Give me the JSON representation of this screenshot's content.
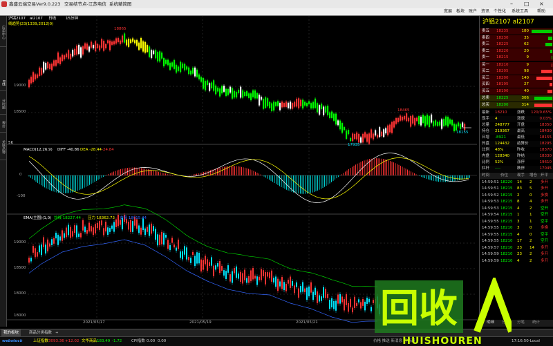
{
  "window": {
    "title": "鑫盛云端交易",
    "version": "Ver9.0.223",
    "center_text": "交易结节点-江苏电信",
    "center_text2": "系统精简图",
    "menu": [
      "宽展",
      "板块",
      "账户",
      "资讯",
      "个性化",
      "系统工具",
      "帮助"
    ]
  },
  "left_tabs": [
    "应用中心",
    "K线",
    "分时图",
    "报价",
    "关联品种"
  ],
  "chart": {
    "header": {
      "contract": "沪铝2107",
      "code": "al2107",
      "mode": "日线",
      "period": "15分钟",
      "indicator": "线趋势(23(1339,2012)0)"
    },
    "price_axis_labels": [
      "19000",
      "18500"
    ],
    "price_annotations": {
      "high": "18865",
      "low": "17935",
      "mid_peak": "18465",
      "last": "18155"
    },
    "macd_header": {
      "label": "MACD(12,26,9)",
      "diff": "DIFF -40.86",
      "dea": "DEA -28.44",
      "macd": "-24.84"
    },
    "macd_axis_labels": [
      "0",
      "-100"
    ],
    "ema_header": {
      "label": "EMA(主图)(1,0)",
      "line1": "均线 18227.44",
      "line2": "压力 18362.73",
      "line3": "支撑 18015.44"
    },
    "ema_axis_labels": [
      "19000",
      "18500",
      "18000"
    ],
    "dates": [
      "2021/05/17",
      "2021/05/19",
      "2021/05/21"
    ],
    "pane_tag": "5K"
  },
  "right_panel": {
    "title": "沪铝2107  al2107",
    "asks": [
      {
        "label": "卖五",
        "price": "18235",
        "vol": "180"
      },
      {
        "label": "卖四",
        "price": "18230",
        "vol": "35"
      },
      {
        "label": "卖三",
        "price": "18225",
        "vol": "62"
      },
      {
        "label": "卖二",
        "price": "18220",
        "vol": "20"
      },
      {
        "label": "卖一",
        "price": "18215",
        "vol": "9"
      }
    ],
    "bids": [
      {
        "label": "买一",
        "price": "18210",
        "vol": "9"
      },
      {
        "label": "买二",
        "price": "18205",
        "vol": "98"
      },
      {
        "label": "买三",
        "price": "18200",
        "vol": "140"
      },
      {
        "label": "买四",
        "price": "18195",
        "vol": "27"
      },
      {
        "label": "买五",
        "price": "18190",
        "vol": "40"
      }
    ],
    "totals": [
      {
        "label": "总卖",
        "price": "18225",
        "vol": "306"
      },
      {
        "label": "总买",
        "price": "18200",
        "vol": "314"
      }
    ],
    "stats": [
      {
        "k1": "最新",
        "v1": "18210",
        "k2": "涨跌",
        "v2": "120/0.65%"
      },
      {
        "k1": "现手",
        "v1": "4",
        "k2": "涨速",
        "v2": "0.03%"
      },
      {
        "k1": "总量",
        "v1": "248777",
        "k2": "开盘",
        "v2": "18350"
      },
      {
        "k1": "持仓",
        "v1": "219367",
        "k2": "最高",
        "v2": "18430"
      },
      {
        "k1": "日增",
        "v1": "-8921",
        "k2": "最低",
        "v2": "18155"
      },
      {
        "k1": "外盘",
        "v1": "124432",
        "k2": "结算价",
        "v2": "18295"
      },
      {
        "k1": "比例",
        "v1": "48%",
        "k2": "昨收",
        "v2": "18370"
      },
      {
        "k1": "内盘",
        "v1": "128340",
        "k2": "昨结",
        "v2": "18330"
      },
      {
        "k1": "比例",
        "v1": "52%",
        "k2": "涨停",
        "v2": "19610"
      },
      {
        "k1": "杠杆",
        "v1": "----",
        "k2": "跌停",
        "v2": "17045"
      }
    ],
    "ticks_header": [
      "时间",
      "价位",
      "现手",
      "增仓",
      "开平"
    ],
    "ticks": [
      {
        "t": "14:59:51",
        "p": "18220",
        "v": "14",
        "d": "2",
        "f": "多开"
      },
      {
        "t": "14:59:51",
        "p": "18215",
        "v": "83",
        "d": "5",
        "f": "多开"
      },
      {
        "t": "14:59:52",
        "p": "18215",
        "v": "2",
        "d": "0",
        "f": "多换"
      },
      {
        "t": "14:59:53",
        "p": "18215",
        "v": "8",
        "d": "4",
        "f": "多开"
      },
      {
        "t": "14:59:53",
        "p": "18215",
        "v": "4",
        "d": "2",
        "f": "空开"
      },
      {
        "t": "14:59:54",
        "p": "18215",
        "v": "1",
        "d": "1",
        "f": "空开"
      },
      {
        "t": "14:59:55",
        "p": "18215",
        "v": "3",
        "d": "1",
        "f": "空平"
      },
      {
        "t": "14:59:55",
        "p": "18210",
        "v": "3",
        "d": "0",
        "f": "多换"
      },
      {
        "t": "14:59:55",
        "p": "18215",
        "v": "4",
        "d": "0",
        "f": "空平"
      },
      {
        "t": "14:59:55",
        "p": "18210",
        "v": "17",
        "d": "2",
        "f": "空开"
      },
      {
        "t": "14:59:57",
        "p": "18210",
        "v": "23",
        "d": "14",
        "f": "多开"
      },
      {
        "t": "14:59:59",
        "p": "18210",
        "v": "23",
        "d": "2",
        "f": "多开"
      },
      {
        "t": "14:59:59",
        "p": "18210",
        "v": "4",
        "d": "2",
        "f": "多开"
      }
    ],
    "bottom_tabs": [
      "明细",
      "分价",
      "分笔",
      "统计"
    ]
  },
  "tabbar": {
    "tabs": [
      "我的板块",
      "商品分类指数"
    ],
    "add": "+"
  },
  "statusbar": {
    "brand": "webstock",
    "idx1_name": "上证指数",
    "idx1_val": "3093.36",
    "idx1_chg": "+12.02",
    "idx2_name": "文华商品",
    "idx2_val": "183.49",
    "idx2_chg": "-1.72",
    "idx3_name": "CPI指数",
    "idx3_val": "0.00",
    "idx3_chg": "0.00",
    "right_text": "价格 推送 新消息 行情通",
    "clock": "17:16:50-Local"
  },
  "watermark": {
    "big": "回收",
    "small": "HUISHOUREN"
  },
  "colors": {
    "up": "#ff3333",
    "down": "#00ff00",
    "yellow": "#ffff00",
    "cyan": "#00e5ff",
    "white": "#ffffff",
    "accent": "#c8ff00"
  }
}
